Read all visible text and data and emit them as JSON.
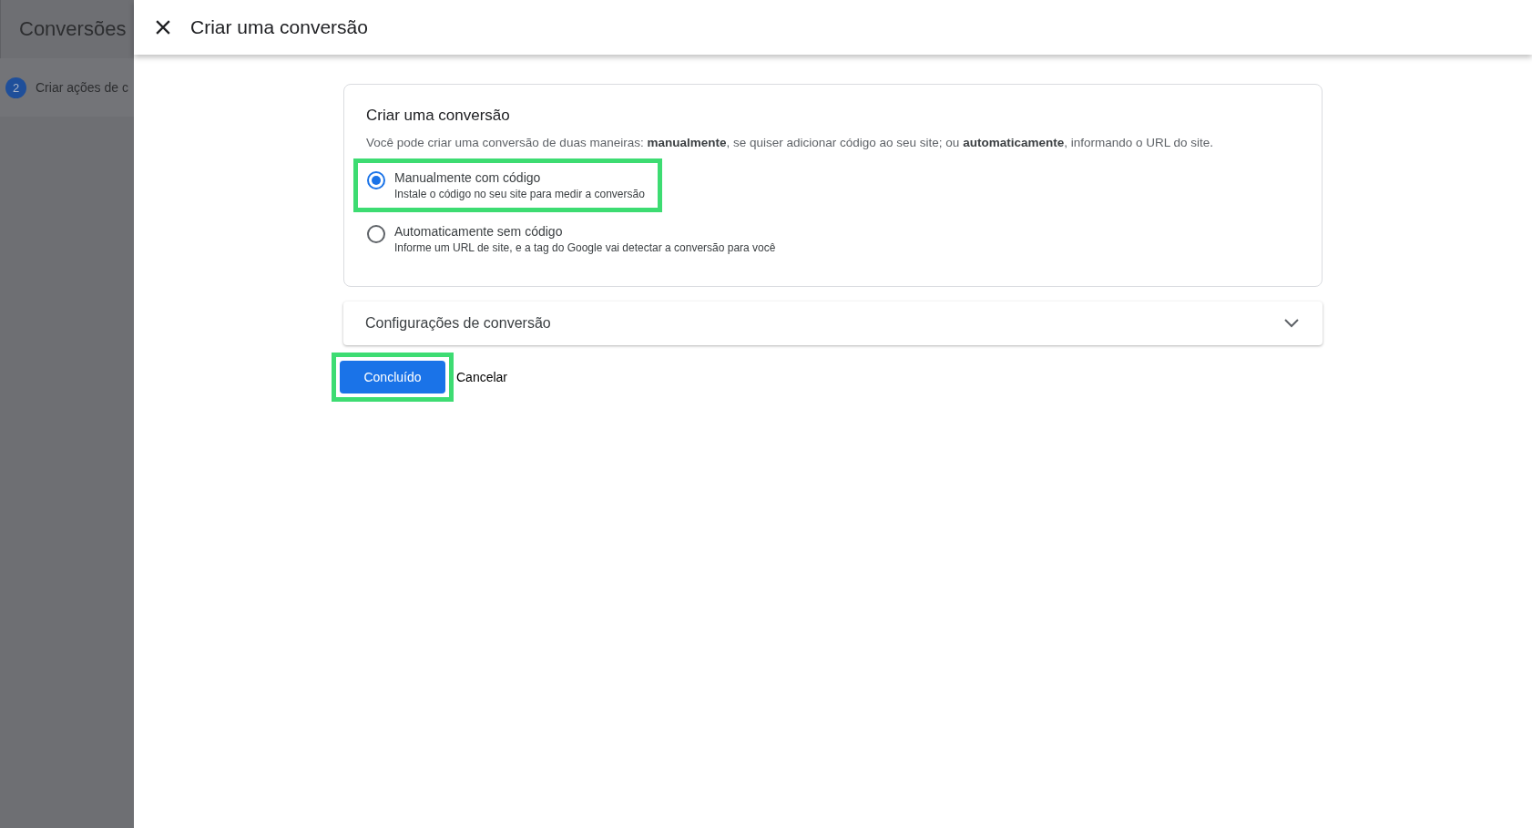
{
  "background_page": {
    "title": "Conversões",
    "step": {
      "number": "2",
      "label": "Criar ações de c"
    }
  },
  "dialog": {
    "title": "Criar uma conversão",
    "card": {
      "heading": "Criar uma conversão",
      "description": "Você pode criar uma conversão de duas maneiras: **manualmente**, se quiser adicionar código ao seu site; ou **automaticamente**, informando o URL do site.",
      "options": [
        {
          "label": "Manualmente com código",
          "hint": "Instale o código no seu site para medir a conversão",
          "selected": true,
          "highlighted": true
        },
        {
          "label": "Automaticamente sem código",
          "hint": "Informe um URL de site, e a tag do Google vai detectar a conversão para você",
          "selected": false,
          "highlighted": false
        }
      ]
    },
    "settings_panel": {
      "label": "Configurações de conversão",
      "expanded": false
    },
    "buttons": [
      {
        "kind": "primary",
        "label": "Concluído",
        "highlighted": true
      },
      {
        "kind": "text",
        "label": "Cancelar",
        "highlighted": false
      }
    ]
  }
}
